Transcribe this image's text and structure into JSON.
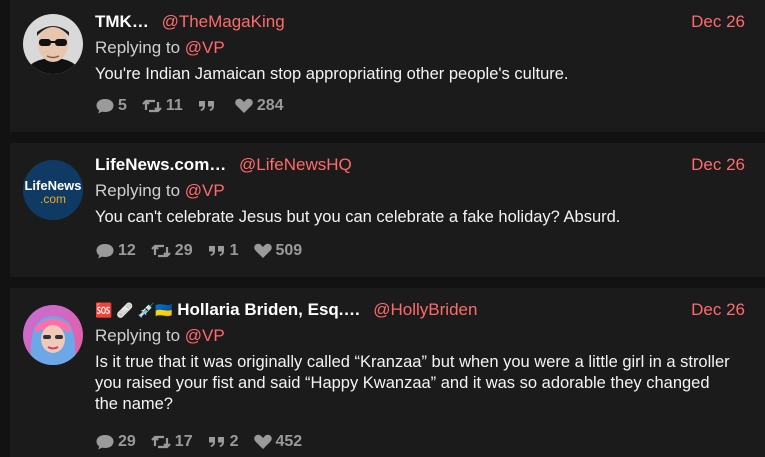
{
  "tweets": [
    {
      "name": "TMK…",
      "handle": "@TheMagaKing",
      "date": "Dec 26",
      "replying_prefix": "Replying to ",
      "replying_to": "@VP",
      "text": "You're Indian Jamaican stop appropriating other people's culture.",
      "replies": "5",
      "retweets": "11",
      "quotes": "",
      "likes": "284",
      "avatar_icon": "sunglasses-man-avatar"
    },
    {
      "name": "LifeNews.com…",
      "handle": "@LifeNewsHQ",
      "date": "Dec 26",
      "replying_prefix": "Replying to ",
      "replying_to": "@VP",
      "text": "You can't celebrate Jesus but you can celebrate a fake holiday? Absurd.",
      "replies": "12",
      "retweets": "29",
      "quotes": "1",
      "likes": "509",
      "avatar_logo": {
        "line1": "LifeNews",
        "line2": ".com"
      }
    },
    {
      "name_emojis": "🆘 🩹 💉🇺🇦",
      "name": "Hollaria Briden, Esq.…",
      "handle": "@HollyBriden",
      "date": "Dec 26",
      "replying_prefix": "Replying to ",
      "replying_to": "@VP",
      "text": "Is it true that it was originally called “Kranzaa” but when you were a little girl in a stroller you raised your fist and said “Happy Kwanzaa” and it was so adorable they changed the name?",
      "replies": "29",
      "retweets": "17",
      "quotes": "2",
      "likes": "452",
      "avatar_icon": "colorful-hair-woman-avatar"
    }
  ],
  "colors": {
    "accent": "#ff6b6b",
    "background": "#121212",
    "card": "#1b1b1b",
    "muted": "#9a9a9a"
  }
}
